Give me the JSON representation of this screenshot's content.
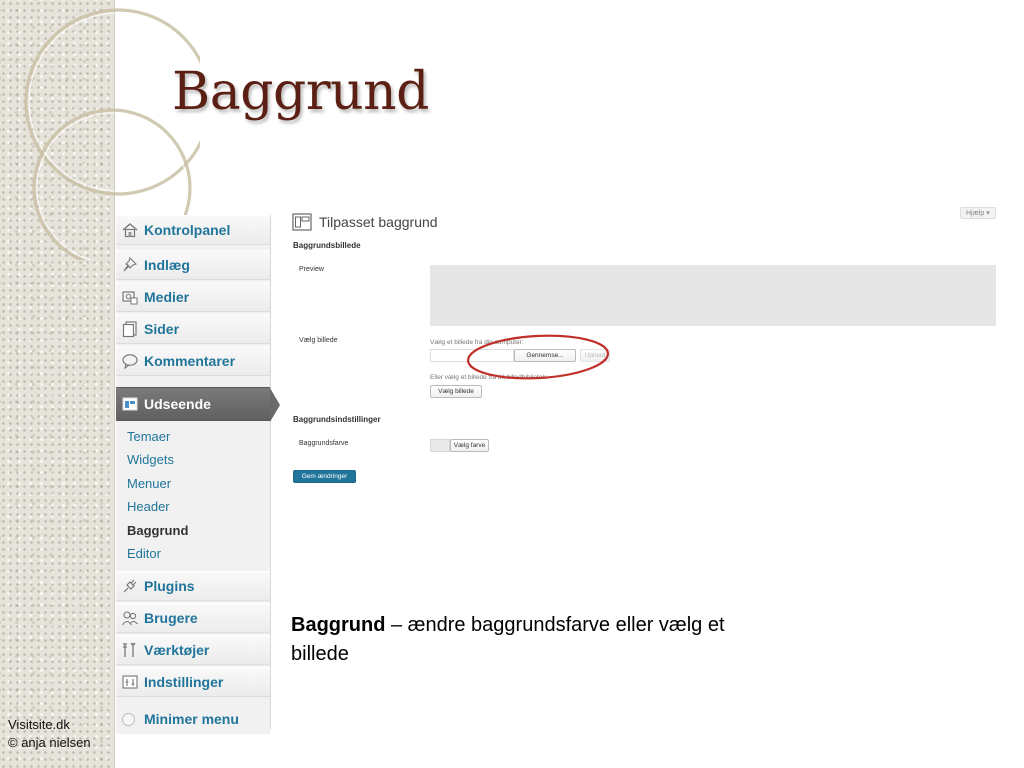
{
  "slide": {
    "title": "Baggrund",
    "caption_bold": "Baggrund",
    "caption_rest": " – ændre baggrundsfarve eller vælg et billede",
    "footer_site": "Visitsite.dk",
    "footer_author": "© anja nielsen",
    "title_color": "#5b1f14"
  },
  "sidebar": {
    "items": [
      {
        "label": "Kontrolpanel",
        "icon": "home-icon"
      },
      {
        "label": "Indlæg",
        "icon": "pin-icon"
      },
      {
        "label": "Medier",
        "icon": "media-icon"
      },
      {
        "label": "Sider",
        "icon": "pages-icon"
      },
      {
        "label": "Kommentarer",
        "icon": "comment-icon"
      },
      {
        "label": "Udseende",
        "icon": "appearance-icon"
      }
    ],
    "submenu": [
      {
        "label": "Temaer"
      },
      {
        "label": "Widgets"
      },
      {
        "label": "Menuer"
      },
      {
        "label": "Header"
      },
      {
        "label": "Baggrund"
      },
      {
        "label": "Editor"
      }
    ],
    "bottom_items": [
      {
        "label": "Plugins",
        "icon": "plug-icon"
      },
      {
        "label": "Brugere",
        "icon": "users-icon"
      },
      {
        "label": "Værktøjer",
        "icon": "tools-icon"
      },
      {
        "label": "Indstillinger",
        "icon": "settings-icon"
      }
    ],
    "minimize": "Minimer menu",
    "link_color": "#21759b"
  },
  "main": {
    "help": "Hjælp ▾",
    "heading": "Tilpasset baggrund",
    "section_image": "Baggrundsbillede",
    "preview_label": "Preview",
    "choose_label": "Vælg billede",
    "upload_hint": "Vælg et billede fra din computer:",
    "browse_button": "Gennemse...",
    "upload_button": "Upload",
    "library_hint": "Eller vælg et billede fra dit billedbibliotek:",
    "choose_image_button": "Vælg billede",
    "section_settings": "Baggrundsindstillinger",
    "color_label": "Baggrundsfarve",
    "color_button": "Vælg farve",
    "save_button": "Gem ændringer",
    "annotation_color": "#c0302b"
  }
}
